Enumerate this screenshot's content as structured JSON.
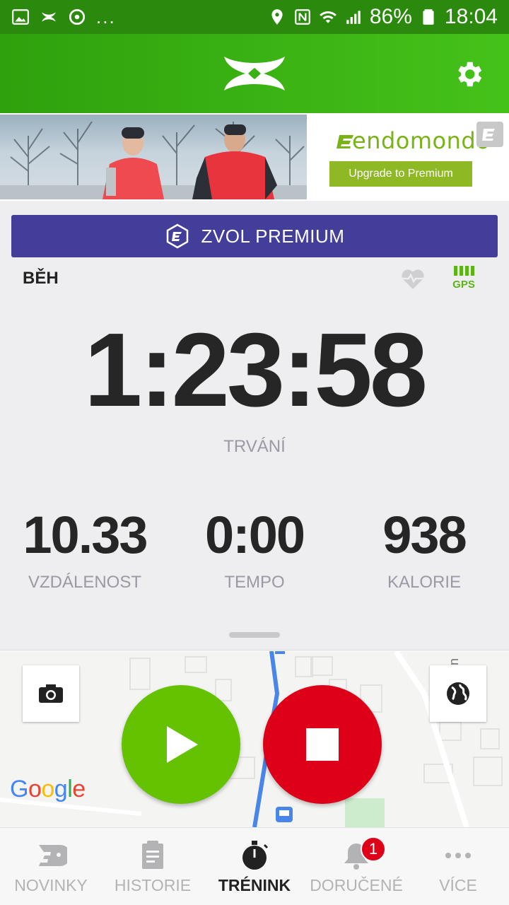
{
  "status_bar": {
    "battery": "86%",
    "time": "18:04",
    "more": "..."
  },
  "app_bar": {
    "logo_icon": "under-armour-logo",
    "settings_icon": "gear-icon"
  },
  "ad": {
    "brand": "endomondo",
    "cta": "Upgrade to Premium"
  },
  "premium_button": {
    "label": "ZVOL PREMIUM"
  },
  "workout": {
    "sport": "BĚH",
    "gps_label": "GPS",
    "duration": "1:23:58",
    "duration_label": "TRVÁNÍ",
    "stats": [
      {
        "value": "10.33",
        "label": "VZDÁLENOST"
      },
      {
        "value": "0:00",
        "label": "TEMPO"
      },
      {
        "value": "938",
        "label": "KALORIE"
      }
    ]
  },
  "map": {
    "provider": "Google",
    "colors": {
      "route": "#4a86e8",
      "play": "#65c200",
      "stop": "#dd0018"
    }
  },
  "bottom_nav": {
    "items": [
      {
        "label": "NOVINKY",
        "icon": "news-icon"
      },
      {
        "label": "HISTORIE",
        "icon": "history-icon"
      },
      {
        "label": "TRÉNINK",
        "icon": "stopwatch-icon",
        "active": true
      },
      {
        "label": "DORUČENÉ",
        "icon": "bell-icon",
        "badge": "1"
      },
      {
        "label": "VÍCE",
        "icon": "more-icon"
      }
    ]
  }
}
